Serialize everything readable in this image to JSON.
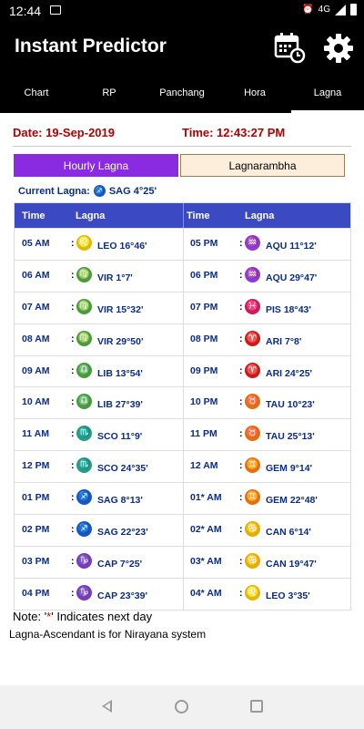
{
  "status_bar": {
    "time": "12:44",
    "network": "4G"
  },
  "app_bar": {
    "title": "Instant Predictor"
  },
  "tabs": [
    {
      "label": "Chart",
      "active": false
    },
    {
      "label": "RP",
      "active": false
    },
    {
      "label": "Panchang",
      "active": false
    },
    {
      "label": "Hora",
      "active": false
    },
    {
      "label": "Lagna",
      "active": true
    }
  ],
  "header": {
    "date": "Date: 19-Sep-2019",
    "time": "Time: 12:43:27 PM"
  },
  "toggle": {
    "left": "Hourly Lagna",
    "right": "Lagnarambha"
  },
  "current_lagna": {
    "label": "Current Lagna:",
    "sign": "sagittarius",
    "value": "SAG 4°25'"
  },
  "table": {
    "headers": {
      "time": "Time",
      "lagna": "Lagna"
    },
    "left": [
      {
        "time": "05 AM",
        "sign": "leo",
        "value": "LEO 16°46'"
      },
      {
        "time": "06 AM",
        "sign": "virgo",
        "value": "VIR 1°7'"
      },
      {
        "time": "07 AM",
        "sign": "virgo",
        "value": "VIR 15°32'"
      },
      {
        "time": "08 AM",
        "sign": "virgo",
        "value": "VIR 29°50'"
      },
      {
        "time": "09 AM",
        "sign": "libra",
        "value": "LIB 13°54'"
      },
      {
        "time": "10 AM",
        "sign": "libra",
        "value": "LIB 27°39'"
      },
      {
        "time": "11 AM",
        "sign": "scorpio",
        "value": "SCO 11°9'"
      },
      {
        "time": "12 PM",
        "sign": "scorpio",
        "value": "SCO 24°35'"
      },
      {
        "time": "01 PM",
        "sign": "sagittarius",
        "value": "SAG 8°13'"
      },
      {
        "time": "02 PM",
        "sign": "sagittarius",
        "value": "SAG 22°23'"
      },
      {
        "time": "03 PM",
        "sign": "capricorn",
        "value": "CAP 7°25'"
      },
      {
        "time": "04 PM",
        "sign": "capricorn",
        "value": "CAP 23°39'"
      }
    ],
    "right": [
      {
        "time": "05 PM",
        "sign": "aquarius",
        "value": "AQU 11°12'"
      },
      {
        "time": "06 PM",
        "sign": "aquarius",
        "value": "AQU 29°47'"
      },
      {
        "time": "07 PM",
        "sign": "pisces",
        "value": "PIS 18°43'"
      },
      {
        "time": "08 PM",
        "sign": "aries",
        "value": "ARI 7°8'"
      },
      {
        "time": "09 PM",
        "sign": "aries",
        "value": "ARI 24°25'"
      },
      {
        "time": "10 PM",
        "sign": "taurus",
        "value": "TAU 10°23'"
      },
      {
        "time": "11 PM",
        "sign": "taurus",
        "value": "TAU 25°13'"
      },
      {
        "time": "12 AM",
        "sign": "gemini",
        "value": "GEM 9°14'"
      },
      {
        "time": "01* AM",
        "sign": "gemini",
        "value": "GEM 22°48'"
      },
      {
        "time": "02* AM",
        "sign": "cancer",
        "value": "CAN 6°14'"
      },
      {
        "time": "03* AM",
        "sign": "cancer",
        "value": "CAN 19°47'"
      },
      {
        "time": "04* AM",
        "sign": "leo",
        "value": "LEO 3°35'"
      }
    ]
  },
  "notes": {
    "note_prefix": "Note: '",
    "note_star": "*",
    "note_suffix": "' Indicates next day",
    "line2": "Lagna-Ascendant is for Nirayana system"
  },
  "sign_colors": {
    "leo": "#e0b800",
    "virgo": "#4a9a3a",
    "libra": "#4a9a3a",
    "scorpio": "#2b9a82",
    "sagittarius": "#1a55c8",
    "capricorn": "#7b3ab8",
    "aquarius": "#8a3ad8",
    "pisces": "#d0185a",
    "aries": "#d01818",
    "taurus": "#e07010",
    "gemini": "#e07010",
    "cancer": "#e0b000"
  },
  "sign_glyphs": {
    "leo": "♌",
    "virgo": "♍",
    "libra": "♎",
    "scorpio": "♏",
    "sagittarius": "♐",
    "capricorn": "♑",
    "aquarius": "♒",
    "pisces": "♓",
    "aries": "♈",
    "taurus": "♉",
    "gemini": "♊",
    "cancer": "♋"
  }
}
